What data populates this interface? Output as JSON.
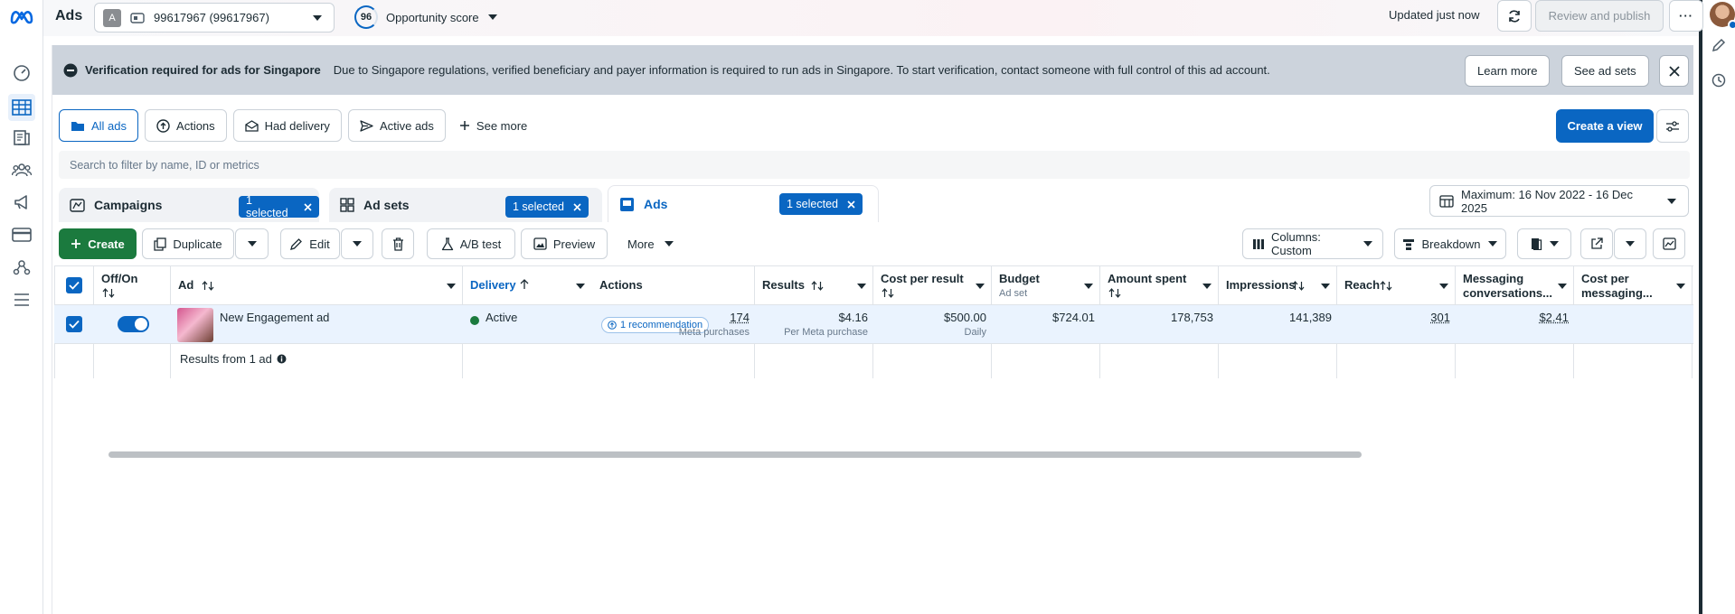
{
  "app": {
    "title": "Ads",
    "account_letter": "A",
    "account_name": "99617967 (99617967)",
    "opportunity_score": "96",
    "opportunity_label": "Opportunity score",
    "updated_text": "Updated just now",
    "review_publish_label": "Review and publish",
    "more_label": "···"
  },
  "banner": {
    "title": "Verification required for ads for Singapore",
    "message": "Due to Singapore regulations, verified beneficiary and payer information is required to run ads in Singapore. To start verification, contact someone with full control of this ad account.",
    "learn_more": "Learn more",
    "see_ad_sets": "See ad sets"
  },
  "views": {
    "items": [
      "All ads",
      "Actions",
      "Had delivery",
      "Active ads"
    ],
    "see_more": "See more",
    "create_view": "Create a view"
  },
  "search": {
    "placeholder": "Search to filter by name, ID or metrics"
  },
  "levels": {
    "campaigns": "Campaigns",
    "ad_sets": "Ad sets",
    "ads": "Ads",
    "selected_label": "1 selected",
    "date_range": "Maximum: 16 Nov 2022 - 16 Dec 2025"
  },
  "toolbar": {
    "create": "Create",
    "duplicate": "Duplicate",
    "edit": "Edit",
    "ab_test": "A/B test",
    "preview": "Preview",
    "more": "More",
    "columns": "Columns: Custom",
    "breakdown": "Breakdown"
  },
  "table": {
    "headers": {
      "off_on": "Off/On",
      "ad": "Ad",
      "delivery": "Delivery",
      "actions": "Actions",
      "results": "Results",
      "cost_per_result": "Cost per result",
      "budget": "Budget",
      "budget_sub": "Ad set",
      "amount_spent": "Amount spent",
      "impressions": "Impressions",
      "reach": "Reach",
      "messaging": "Messaging",
      "messaging2": "conversations...",
      "cost_messaging": "Cost per",
      "cost_messaging2": "messaging..."
    },
    "row": {
      "ad_name": "New Engagement ad",
      "delivery": "Active",
      "recommendation": "1 recommendation",
      "results": "174",
      "results_sub": "Meta purchases",
      "cost_per_result": "$4.16",
      "cost_per_result_sub": "Per Meta purchase",
      "budget": "$500.00",
      "budget_sub": "Daily",
      "amount_spent": "$724.01",
      "impressions": "178,753",
      "reach": "141,389",
      "messaging": "301",
      "cost_messaging": "$2.41"
    },
    "summary": "Results from 1 ad"
  },
  "colors": {
    "accent": "#0a66c2",
    "create_green": "#1b7a3e",
    "active_dot": "#1b7a3e",
    "banner_bg": "#ccd3dc"
  }
}
